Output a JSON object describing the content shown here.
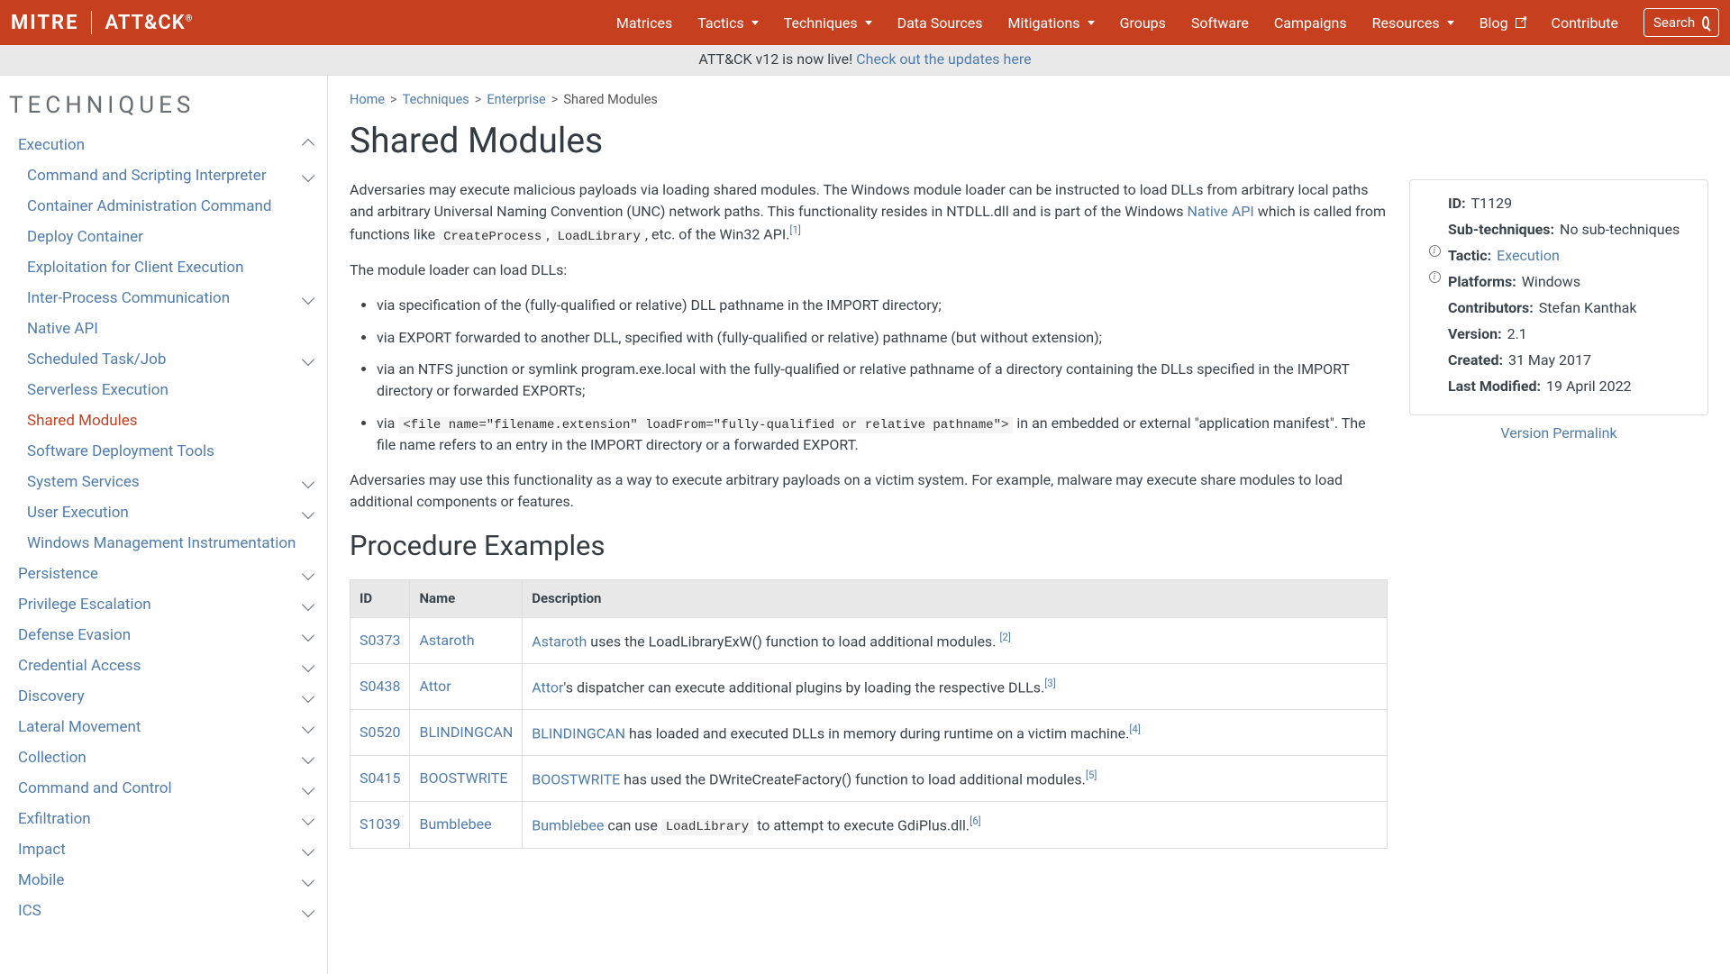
{
  "nav": {
    "logo_mitre": "MITRE",
    "logo_attack": "ATT&CK",
    "items": [
      {
        "label": "Matrices",
        "dropdown": false
      },
      {
        "label": "Tactics",
        "dropdown": true
      },
      {
        "label": "Techniques",
        "dropdown": true
      },
      {
        "label": "Data Sources",
        "dropdown": false
      },
      {
        "label": "Mitigations",
        "dropdown": true
      },
      {
        "label": "Groups",
        "dropdown": false
      },
      {
        "label": "Software",
        "dropdown": false
      },
      {
        "label": "Campaigns",
        "dropdown": false
      },
      {
        "label": "Resources",
        "dropdown": true
      },
      {
        "label": "Blog",
        "dropdown": false,
        "ext": true
      },
      {
        "label": "Contribute",
        "dropdown": false
      }
    ],
    "search_placeholder": "Search"
  },
  "banner": {
    "text": "ATT&CK v12 is now live! ",
    "link": "Check out the updates here"
  },
  "sidebar": {
    "heading": "TECHNIQUES",
    "group": "Execution",
    "children": [
      {
        "label": "Command and Scripting Interpreter",
        "exp": true
      },
      {
        "label": "Container Administration Command",
        "exp": false
      },
      {
        "label": "Deploy Container",
        "exp": false
      },
      {
        "label": "Exploitation for Client Execution",
        "exp": false
      },
      {
        "label": "Inter-Process Communication",
        "exp": true
      },
      {
        "label": "Native API",
        "exp": false
      },
      {
        "label": "Scheduled Task/Job",
        "exp": true
      },
      {
        "label": "Serverless Execution",
        "exp": false
      },
      {
        "label": "Shared Modules",
        "exp": false,
        "active": true
      },
      {
        "label": "Software Deployment Tools",
        "exp": false
      },
      {
        "label": "System Services",
        "exp": true
      },
      {
        "label": "User Execution",
        "exp": true
      },
      {
        "label": "Windows Management Instrumentation",
        "exp": false
      }
    ],
    "tactics": [
      {
        "label": "Persistence"
      },
      {
        "label": "Privilege Escalation"
      },
      {
        "label": "Defense Evasion"
      },
      {
        "label": "Credential Access"
      },
      {
        "label": "Discovery"
      },
      {
        "label": "Lateral Movement"
      },
      {
        "label": "Collection"
      },
      {
        "label": "Command and Control"
      },
      {
        "label": "Exfiltration"
      },
      {
        "label": "Impact"
      },
      {
        "label": "Mobile"
      },
      {
        "label": "ICS"
      }
    ]
  },
  "breadcrumbs": [
    {
      "label": "Home",
      "link": true
    },
    {
      "label": "Techniques",
      "link": true
    },
    {
      "label": "Enterprise",
      "link": true
    },
    {
      "label": "Shared Modules",
      "link": false
    }
  ],
  "page": {
    "title": "Shared Modules",
    "p1a": "Adversaries may execute malicious payloads via loading shared modules. The Windows module loader can be instructed to load DLLs from arbitrary local paths and arbitrary Universal Naming Convention (UNC) network paths. This functionality resides in NTDLL.dll and is part of the Windows ",
    "p1_link": "Native API",
    "p1b": " which is called from functions like ",
    "p1_code1": "CreateProcess",
    "p1_comma": ", ",
    "p1_code2": "LoadLibrary",
    "p1c": ", etc. of the Win32 API.",
    "p1_ref": "[1]",
    "p2": "The module loader can load DLLs:",
    "li1": "via specification of the (fully-qualified or relative) DLL pathname in the IMPORT directory;",
    "li2": "via EXPORT forwarded to another DLL, specified with (fully-qualified or relative) pathname (but without extension);",
    "li3": "via an NTFS junction or symlink program.exe.local with the fully-qualified or relative pathname of a directory containing the DLLs specified in the IMPORT directory or forwarded EXPORTs;",
    "li4a": "via ",
    "li4_code": "<file name=\"filename.extension\" loadFrom=\"fully-qualified or relative pathname\">",
    "li4b": " in an embedded or external \"application manifest\". The file name refers to an entry in the IMPORT directory or a forwarded EXPORT.",
    "p3": "Adversaries may use this functionality as a way to execute arbitrary payloads on a victim system. For example, malware may execute share modules to load additional components or features.",
    "proc_heading": "Procedure Examples"
  },
  "info": {
    "id_l": "ID:",
    "id_v": "T1129",
    "sub_l": "Sub-techniques:",
    "sub_v": " No sub-techniques",
    "tac_l": "Tactic:",
    "tac_v": "Execution",
    "plat_l": "Platforms:",
    "plat_v": "Windows",
    "con_l": "Contributors:",
    "con_v": "Stefan Kanthak",
    "ver_l": "Version:",
    "ver_v": "2.1",
    "cre_l": "Created:",
    "cre_v": "31 May 2017",
    "mod_l": "Last Modified:",
    "mod_v": "19 April 2022",
    "perma": "Version Permalink"
  },
  "table": {
    "h1": "ID",
    "h2": "Name",
    "h3": "Description",
    "rows": [
      {
        "id": "S0373",
        "name": "Astaroth",
        "d_link": "Astaroth",
        "d_text": " uses the LoadLibraryExW() function to load additional modules. ",
        "ref": "[2]"
      },
      {
        "id": "S0438",
        "name": "Attor",
        "d_link": "Attor",
        "d_text": "'s dispatcher can execute additional plugins by loading the respective DLLs.",
        "ref": "[3]"
      },
      {
        "id": "S0520",
        "name": "BLINDINGCAN",
        "d_link": "BLINDINGCAN",
        "d_text": " has loaded and executed DLLs in memory during runtime on a victim machine.",
        "ref": "[4]"
      },
      {
        "id": "S0415",
        "name": "BOOSTWRITE",
        "d_link": "BOOSTWRITE",
        "d_text": " has used the DWriteCreateFactory() function to load additional modules.",
        "ref": "[5]"
      },
      {
        "id": "S1039",
        "name": "Bumblebee",
        "d_link": "Bumblebee",
        "d_pre": " can use ",
        "d_code": "LoadLibrary",
        "d_post": " to attempt to execute GdiPlus.dll.",
        "ref": "[6]"
      }
    ]
  }
}
